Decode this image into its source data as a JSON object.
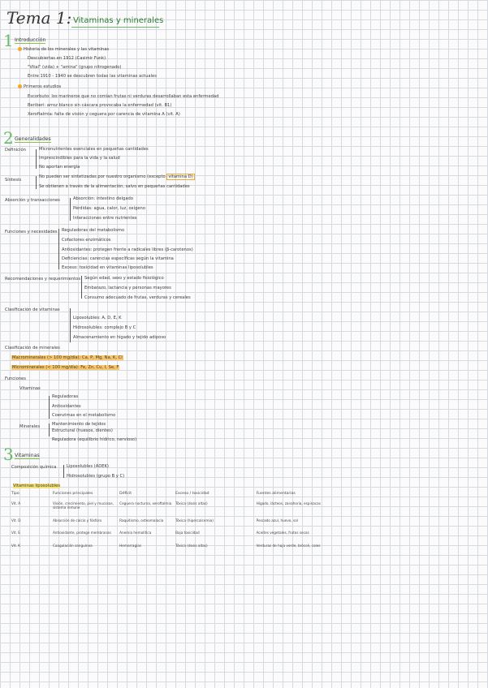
{
  "title": {
    "main": "Tema 1:",
    "subtitle": "Vitaminas y minerales"
  },
  "sections": [
    {
      "number": "1",
      "heading": "Introducción"
    },
    {
      "number": "2",
      "heading": "Generalidades"
    },
    {
      "number": "3",
      "heading": "Vitaminas"
    }
  ],
  "intro": {
    "point_a": "Historia de los minerales y las vitaminas",
    "point_a_items": [
      "Descubiertas en 1912 (Casimir Funk)",
      "\"Vital\" (vida) + \"amina\" (grupo nitrogenado)",
      "Entre 1910 - 1940 se descubren todas las vitaminas actuales"
    ],
    "point_b": "Primeros estudios",
    "point_b_items": [
      "Escorbuto: los marineros que no comían frutas ni verduras desarrollaban esta enfermedad",
      "Beriberi: arroz blanco sin cáscara provocaba la enfermedad (vit. B1)",
      "Xeroftalmia: falta de visión y ceguera por carencia de vitamina A (vit. A)"
    ]
  },
  "generalidades": {
    "definicion_label": "Definición",
    "definicion_items": [
      "Micronutrientes esenciales en pequeñas cantidades",
      "Imprescindibles para la vida y la salud",
      "No aportan energía"
    ],
    "sintesis_label": "Síntesis",
    "sintesis_items": [
      "No pueden ser sintetizadas por nuestro organismo (excepto",
      "vitamina D)",
      "Se obtienen a través de la alimentación, salvo en pequeñas cantidades"
    ],
    "absorcion_label": "Absorción y transacciones",
    "absorcion_items": [
      "Absorción: intestino delgado",
      "Pérdidas: agua, calor, luz, oxígeno",
      "Interacciones entre nutrientes"
    ],
    "funciones_label": "Funciones y necesidades",
    "funciones_items": [
      "Reguladoras del metabolismo",
      "Cofactores enzimáticos",
      "Antioxidantes: protegen frente a radicales libres (β-carotenos)",
      "Deficiencias: carencias específicas según la vitamina",
      "Exceso: toxicidad en vitaminas liposolubles"
    ],
    "recomendaciones_label": "Recomendaciones y requerimientos",
    "recomendaciones_items": [
      "Según edad, sexo y estado fisiológico",
      "Embarazo, lactancia y personas mayores",
      "Consumo adecuado de frutas, verduras y cereales"
    ],
    "clasificacion_label": "Clasificación de vitaminas",
    "clasificacion_items": [
      "Liposolubles: A, D, E, K",
      "Hidrosolubles: complejo B y C",
      "Almacenamiento en hígado y tejido adiposo"
    ],
    "minerales_label": "Clasificación de minerales",
    "minerales_items": [
      "Macrominerales (> 100 mg/día): Ca, P, Mg, Na, K, Cl",
      "Microminerales (< 100 mg/día): Fe, Zn, Cu, I, Se, F"
    ],
    "fuentes_label": "Funciones",
    "fuentes_sub1": "Vitaminas",
    "fuentes_sub1_items": [
      "Reguladoras",
      "Antioxidantes",
      "Coenzimas en el metabolismo",
      "Mantenimiento de tejidos"
    ],
    "fuentes_sub2": "Minerales",
    "fuentes_sub2_items": [
      "Estructural (huesos, dientes)",
      "Reguladora (equilibrio hídrico, nervioso)"
    ]
  },
  "vitaminas": {
    "compo_label": "Composición química",
    "compo_items": [
      "Liposolubles (ADEK)",
      "Hidrosolubles (grupo B y C)"
    ],
    "table_title": "Vitaminas liposolubles",
    "columns": [
      "Tipo",
      "Funciones principales",
      "Déficit",
      "Exceso / toxicidad",
      "Fuentes alimentarias"
    ],
    "rows": [
      {
        "tipo": "Vit. A",
        "funcion": "Visión, crecimiento, piel y mucosas, sistema inmune",
        "deficit": "Ceguera nocturna, xeroftalmia",
        "exceso": "Tóxica (dosis altas)",
        "fuentes": "Hígado, lácteos, zanahoria, espinacas"
      },
      {
        "tipo": "Vit. D",
        "funcion": "Absorción de calcio y fósforo",
        "deficit": "Raquitismo, osteomalacia",
        "exceso": "Tóxica (hipercalcemia)",
        "fuentes": "Pescado azul, huevo, sol"
      },
      {
        "tipo": "Vit. E",
        "funcion": "Antioxidante, protege membranas",
        "deficit": "Anemia hemolítica",
        "exceso": "Baja toxicidad",
        "fuentes": "Aceites vegetales, frutos secos"
      },
      {
        "tipo": "Vit. K",
        "funcion": "Coagulación sanguínea",
        "deficit": "Hemorragias",
        "exceso": "Tóxica (dosis altas)",
        "fuentes": "Verduras de hoja verde, brócoli, coles"
      }
    ]
  }
}
